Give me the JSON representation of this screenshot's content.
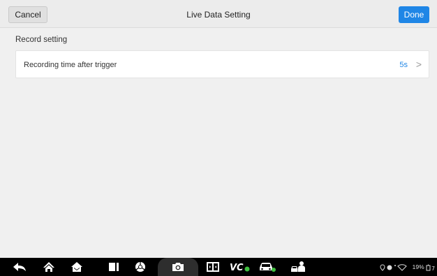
{
  "header": {
    "cancel_label": "Cancel",
    "title": "Live Data Setting",
    "done_label": "Done"
  },
  "section": {
    "label": "Record setting"
  },
  "settings_row": {
    "label": "Recording time after trigger",
    "value": "5s",
    "chevron": ">"
  },
  "navbar": {
    "icons": [
      "back-icon",
      "home-icon",
      "autel-home-icon",
      "recent-apps-icon",
      "chrome-icon",
      "camera-icon",
      "display-icon",
      "vci-icon",
      "car-icon",
      "car-service-icon"
    ],
    "status_text": "19%"
  },
  "colors": {
    "accent": "#1f86e6",
    "navbar_bg": "#000000",
    "page_bg": "#f0f0f0"
  }
}
